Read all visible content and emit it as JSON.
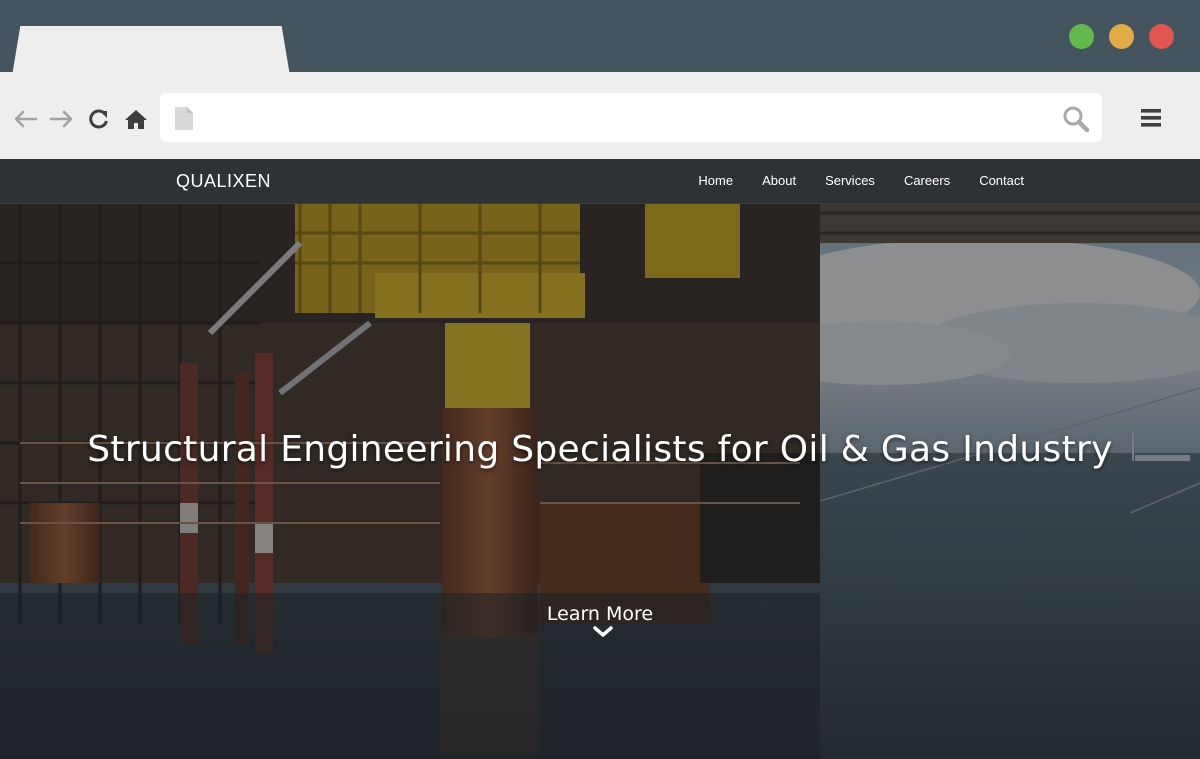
{
  "browser": {
    "window_controls": {
      "green": "#63b94c",
      "yellow": "#e2ab46",
      "red": "#e1574f"
    },
    "toolbar_icons": [
      "back-arrow-icon",
      "forward-arrow-icon",
      "reload-icon",
      "home-icon",
      "page-icon",
      "search-icon",
      "hamburger-menu-icon"
    ]
  },
  "site": {
    "brand": "QUALIXEN",
    "nav": [
      {
        "label": "Home"
      },
      {
        "label": "About"
      },
      {
        "label": "Services"
      },
      {
        "label": "Careers"
      },
      {
        "label": "Contact"
      }
    ]
  },
  "hero": {
    "title": "Structural Engineering Specialists for Oil & Gas Industry",
    "cta_label": "Learn More",
    "cta_icon": "chevron-down-icon"
  },
  "colors": {
    "chrome_bg": "#455560",
    "toolbar_bg": "#eeeeef",
    "navbar_bg": "#2f3235",
    "platform_yellow": "#d9b21f",
    "rust": "#8a4a2a",
    "sea": "#3c4a55"
  }
}
